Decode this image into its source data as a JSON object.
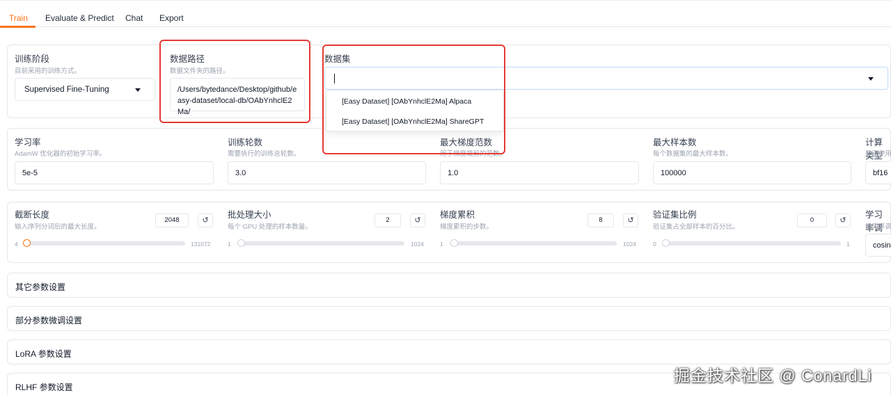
{
  "tabs": [
    {
      "label": "Train",
      "active": true
    },
    {
      "label": "Evaluate & Predict",
      "active": false
    },
    {
      "label": "Chat",
      "active": false
    },
    {
      "label": "Export",
      "active": false
    }
  ],
  "stage": {
    "label": "训练阶段",
    "info": "目前采用的训练方式。",
    "value": "Supervised Fine-Tuning"
  },
  "dataset_dir": {
    "label": "数据路径",
    "info": "数据文件夹的路径。",
    "value": "/Users/bytedance/Desktop/github/easy-dataset/local-db/OAbYnhclE2Ma/"
  },
  "dataset": {
    "label": "数据集",
    "value": "",
    "options": [
      "[Easy Dataset] [OAbYnhclE2Ma] Alpaca",
      "[Easy Dataset] [OAbYnhclE2Ma] ShareGPT"
    ]
  },
  "row2": [
    {
      "label": "学习率",
      "info": "AdamW 优化器的初始学习率。",
      "value": "5e-5"
    },
    {
      "label": "训练轮数",
      "info": "需要执行的训练总轮数。",
      "value": "3.0"
    },
    {
      "label": "最大梯度范数",
      "info": "用于梯度裁剪的范数。",
      "value": "1.0"
    },
    {
      "label": "最大样本数",
      "info": "每个数据集的最大样本数。",
      "value": "100000"
    },
    {
      "label": "计算类型",
      "info": "是否使用",
      "value": "bf16"
    }
  ],
  "row3": [
    {
      "label": "截断长度",
      "info": "输入序列分词后的最大长度。",
      "value": "2048",
      "min": "4",
      "max": "131072",
      "level": 0.015
    },
    {
      "label": "批处理大小",
      "info": "每个 GPU 处理的样本数量。",
      "value": "2",
      "min": "1",
      "max": "1024",
      "level": 0.001
    },
    {
      "label": "梯度累积",
      "info": "梯度累积的步数。",
      "value": "8",
      "min": "1",
      "max": "1024",
      "level": 0.007
    },
    {
      "label": "验证集比例",
      "info": "验证集占全部样本的百分比。",
      "value": "0",
      "min": "0",
      "max": "1",
      "level": 0.0
    },
    {
      "label": "学习率调",
      "info": "学习率调",
      "value": "cosin"
    }
  ],
  "accordions": [
    "其它参数设置",
    "部分参数微调设置",
    "LoRA 参数设置",
    "RLHF 参数设置"
  ],
  "reset_icon": "↺",
  "watermark": "掘金技术社区 @ ConardLi",
  "colors": {
    "accent": "#f97316",
    "highlight": "#e53935"
  }
}
